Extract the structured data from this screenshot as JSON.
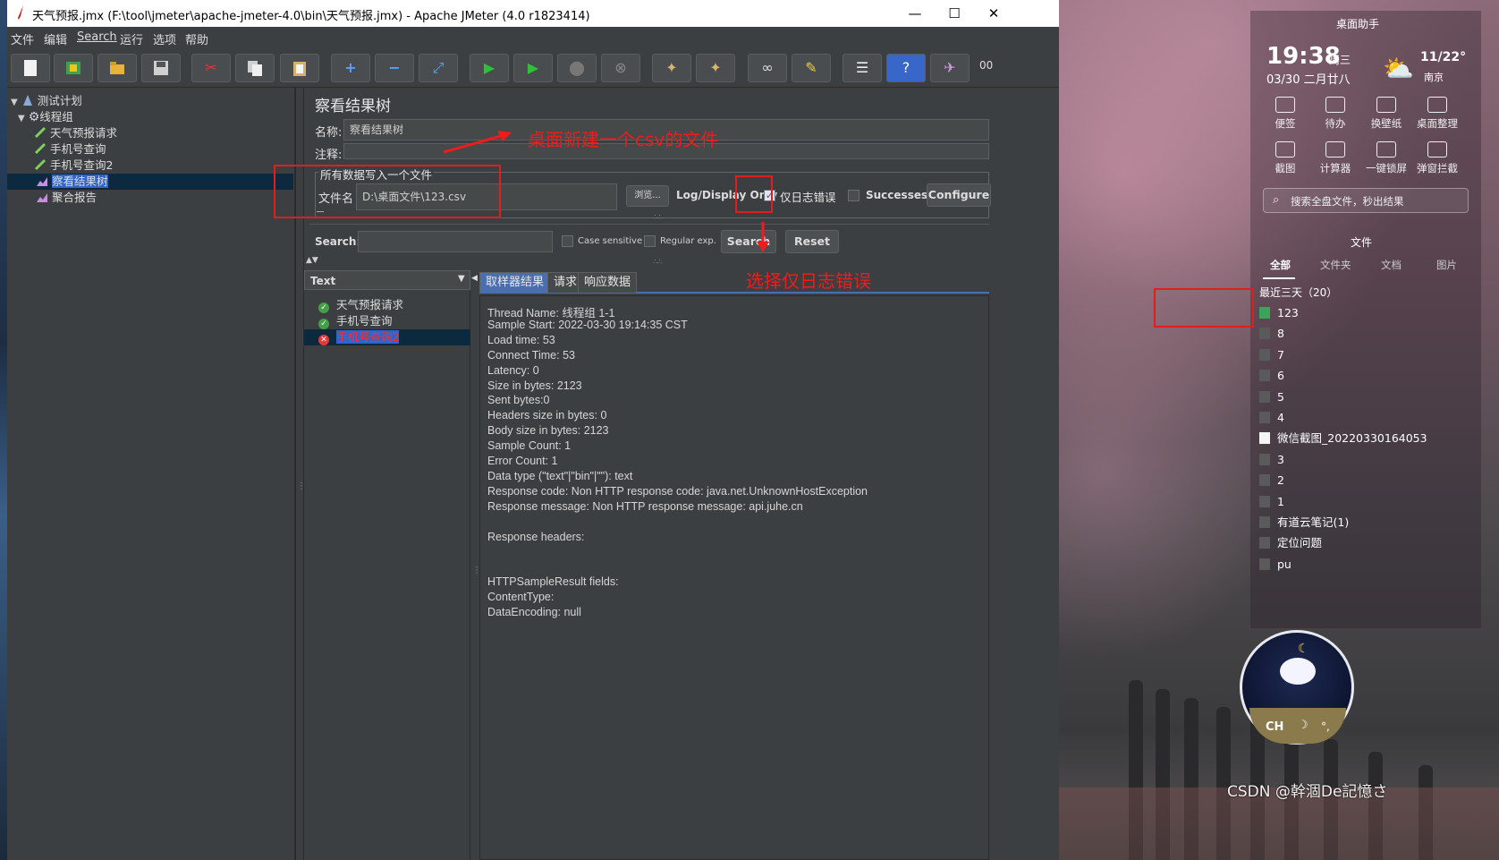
{
  "window": {
    "title": "天气预报.jmx (F:\\tool\\jmeter\\apache-jmeter-4.0\\bin\\天气预报.jmx) - Apache JMeter (4.0 r1823414)",
    "minimize": "—",
    "maximize": "☐",
    "close": "✕"
  },
  "menu": [
    "文件",
    "编辑",
    "Search",
    "运行",
    "选项",
    "帮助"
  ],
  "toolbar": {
    "overflow_label": "00"
  },
  "tree": {
    "items": [
      {
        "label": "测试计划",
        "icon": "test-plan-icon"
      },
      {
        "label": "线程组",
        "icon": "gear-icon"
      },
      {
        "label": "天气预报请求",
        "icon": "sampler-icon"
      },
      {
        "label": "手机号查询",
        "icon": "sampler-icon"
      },
      {
        "label": "手机号查询2",
        "icon": "sampler-icon"
      },
      {
        "label": "察看结果树",
        "icon": "listener-icon"
      },
      {
        "label": "聚合报告",
        "icon": "listener-icon"
      }
    ]
  },
  "panel": {
    "title": "察看结果树",
    "name_label": "名称:",
    "name_value": "察看结果树",
    "comment_label": "注释:",
    "fieldset_legend": "所有数据写入一个文件",
    "filename_label": "文件名",
    "filename_value": "D:\\桌面文件\\123.csv",
    "browse_button": "浏览...",
    "log_display_only": "Log/Display Only",
    "errors_only_label": "仅日志错误",
    "errors_only_checked": true,
    "successes_label": "Successes",
    "configure_button": "Configure",
    "search_label": "Search:",
    "case_sensitive": "Case sensitive",
    "regular_exp": "Regular exp.",
    "search_button": "Search",
    "reset_button": "Reset",
    "renderer": "Text"
  },
  "results": [
    {
      "label": "天气预报请求",
      "status": "success"
    },
    {
      "label": "手机号查询",
      "status": "success"
    },
    {
      "label": "手机号查询2",
      "status": "error"
    }
  ],
  "tabs": [
    "取样器结果",
    "请求",
    "响应数据"
  ],
  "details": [
    "Thread Name: 线程组 1-1",
    "Sample Start: 2022-03-30 19:14:35 CST",
    "Load time: 53",
    "Connect Time: 53",
    "Latency: 0",
    "Size in bytes: 2123",
    "Sent bytes:0",
    "Headers size in bytes: 0",
    "Body size in bytes: 2123",
    "Sample Count: 1",
    "Error Count: 1",
    "Data type (\"text\"|\"bin\"|\"\"): text",
    "Response code: Non HTTP response code: java.net.UnknownHostException",
    "Response message: Non HTTP response message: api.juhe.cn",
    "",
    "Response headers:",
    "",
    "",
    "HTTPSampleResult fields:",
    "ContentType:",
    "DataEncoding: null"
  ],
  "annotations": {
    "create_csv": "桌面新建一个csv的文件",
    "select_errors": "选择仅日志错误",
    "color": "#ee1c1c"
  },
  "desktop": {
    "widget_title": "桌面助手",
    "time": "19:38",
    "weekday": "周三",
    "date": "03/30 二月廿八",
    "temperature": "11/22°",
    "city": "南京",
    "shortcuts": [
      "便签",
      "待办",
      "换壁纸",
      "桌面整理",
      "截图",
      "计算器",
      "一键锁屏",
      "弹窗拦截"
    ],
    "search_placeholder": "搜索全盘文件，秒出结果",
    "files_header": "文件",
    "file_tabs": [
      "全部",
      "文件夹",
      "文档",
      "图片"
    ],
    "recent_label": "最近三天（20）",
    "files": [
      "123",
      "8",
      "7",
      "6",
      "5",
      "4",
      "微信截图_20220330164053",
      "3",
      "2",
      "1",
      "有道云笔记(1)",
      "定位问题",
      "pu"
    ],
    "ime_label": "CH",
    "watermark": "CSDN @幹涸De記憶さ"
  }
}
